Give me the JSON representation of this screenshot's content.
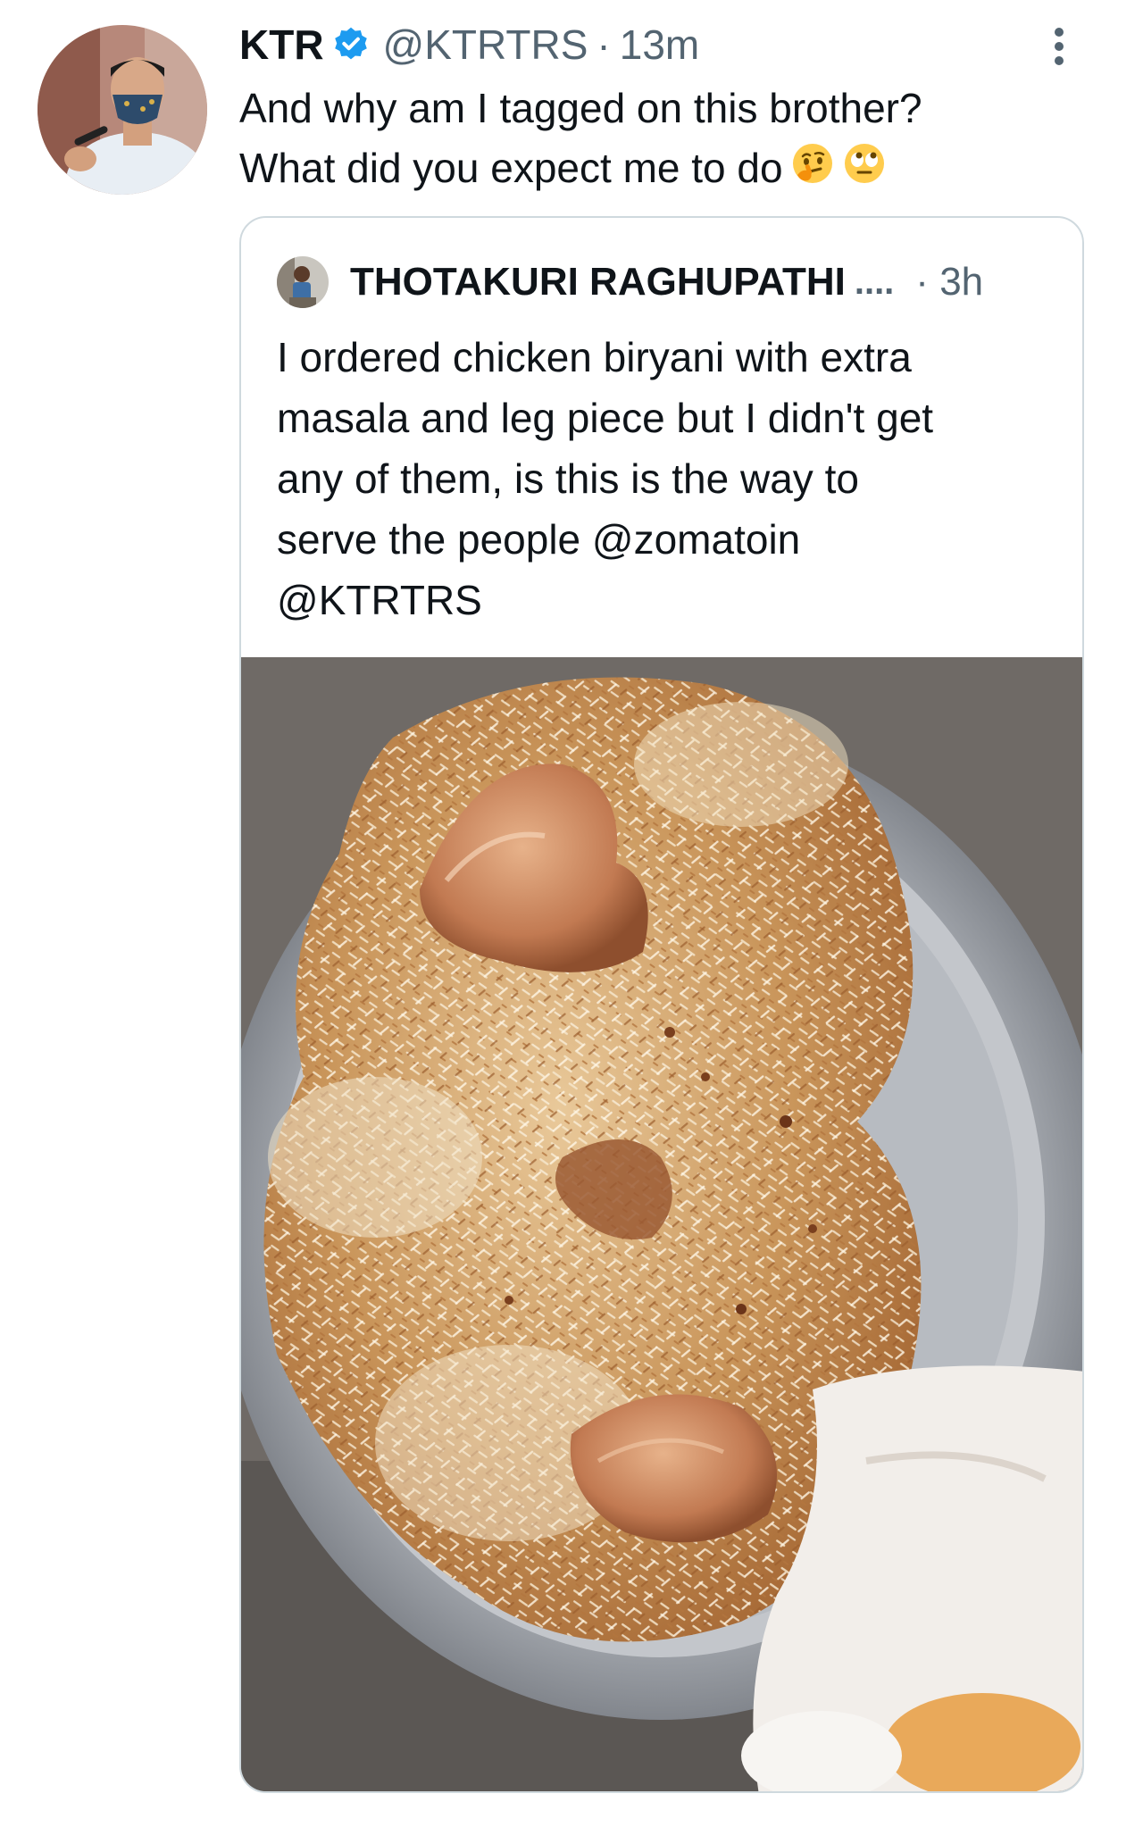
{
  "tweet": {
    "author_name": "KTR",
    "handle": "@KTRTRS",
    "separator": "·",
    "time": "13m",
    "text_lines": [
      "And why am I tagged on this brother?",
      "What did you expect me to do"
    ],
    "emojis": [
      "thinking-face",
      "face-with-rolling-eyes"
    ],
    "icons": {
      "verified": "verified-badge-icon",
      "more": "more-options-icon"
    },
    "colors": {
      "verified": "#1d9bf0",
      "secondary_text": "#536471",
      "card_border": "#cfd9de"
    }
  },
  "quoted_tweet": {
    "author_name": "THOTAKURI RAGHUPATHI",
    "ellipsis": "....",
    "separator": "·",
    "time": "3h",
    "text_lines": [
      "I ordered chicken biryani with extra",
      "masala and leg piece but I didn't get",
      "any of them, is this is the way to",
      "serve the people @zomatoin",
      "@KTRTRS"
    ],
    "photo": "chicken-biryani-on-steel-plate"
  }
}
